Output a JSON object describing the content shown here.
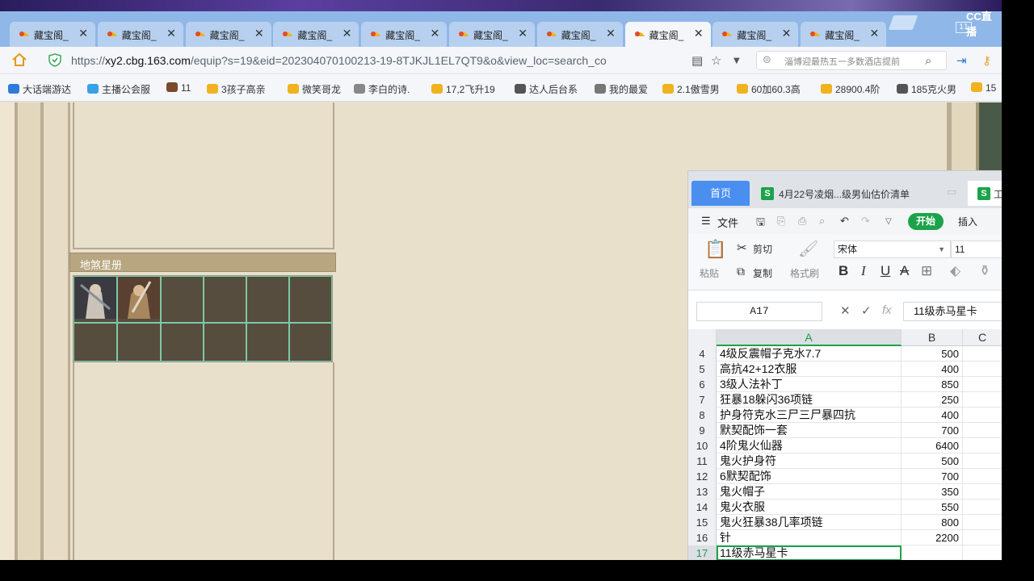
{
  "browser": {
    "tabs": [
      {
        "label": "藏宝阁_",
        "active": false
      },
      {
        "label": "藏宝阁_",
        "active": false
      },
      {
        "label": "藏宝阁_",
        "active": false
      },
      {
        "label": "藏宝阁_",
        "active": false
      },
      {
        "label": "藏宝阁_",
        "active": false
      },
      {
        "label": "藏宝阁_",
        "active": false
      },
      {
        "label": "藏宝阁_",
        "active": false
      },
      {
        "label": "藏宝阁_",
        "active": true
      },
      {
        "label": "藏宝阁_",
        "active": false
      },
      {
        "label": "藏宝阁_",
        "active": false
      }
    ],
    "tab_close_glyph": "✕",
    "overlay_logo": "CC直播",
    "window_count": "11",
    "url_prefix": "https://",
    "url_host": "xy2.cbg.163.com",
    "url_rest": "/equip?s=19&eid=202304070100213-19-8TJKJL1EL7QT9&o&view_loc=search_co",
    "search_placeholder": "淄博迎最热五一多数酒店提前",
    "bookmarks": [
      "大话端游达",
      "主播公会服",
      "11",
      "3孩子高亲",
      "微笑哥龙",
      "李白的诗.",
      "17,2飞升19",
      "达人后台系",
      "我的最爱",
      "2.1傲雪男",
      "60加60.3高",
      "28900.4阶",
      "185克火男",
      "15"
    ]
  },
  "game_page": {
    "section_title": "地煞星册"
  },
  "spreadsheet": {
    "tab_home": "首页",
    "tab_doc1": "4月22号凌烟...级男仙估价清单",
    "tab_doc2": "工",
    "menu_file": "文件",
    "menu_start": "开始",
    "menu_insert": "插入",
    "cut": "剪切",
    "paste": "粘贴",
    "copy": "复制",
    "format_painter": "格式刷",
    "font_name": "宋体",
    "font_size": "11",
    "name_box": "A17",
    "formula_value": "11级赤马星卡",
    "columns": [
      "A",
      "B",
      "C"
    ],
    "rows": [
      {
        "n": "4",
        "a": "4级反震帽子克水7.7",
        "b": "500"
      },
      {
        "n": "5",
        "a": "高抗42+12衣服",
        "b": "400"
      },
      {
        "n": "6",
        "a": "3级人法补丁",
        "b": "850"
      },
      {
        "n": "7",
        "a": "狂暴18躲闪36项链",
        "b": "250"
      },
      {
        "n": "8",
        "a": "护身符克水三尸三尸暴四抗",
        "b": "400"
      },
      {
        "n": "9",
        "a": "默契配饰一套",
        "b": "700"
      },
      {
        "n": "10",
        "a": "4阶鬼火仙器",
        "b": "6400"
      },
      {
        "n": "11",
        "a": "鬼火护身符",
        "b": "500"
      },
      {
        "n": "12",
        "a": "6默契配饰",
        "b": "700"
      },
      {
        "n": "13",
        "a": "鬼火帽子",
        "b": "350"
      },
      {
        "n": "14",
        "a": "鬼火衣服",
        "b": "550"
      },
      {
        "n": "15",
        "a": "鬼火狂暴38几率项链",
        "b": "800"
      },
      {
        "n": "16",
        "a": "针",
        "b": "2200"
      },
      {
        "n": "17",
        "a": "11级赤马星卡",
        "b": ""
      }
    ]
  }
}
